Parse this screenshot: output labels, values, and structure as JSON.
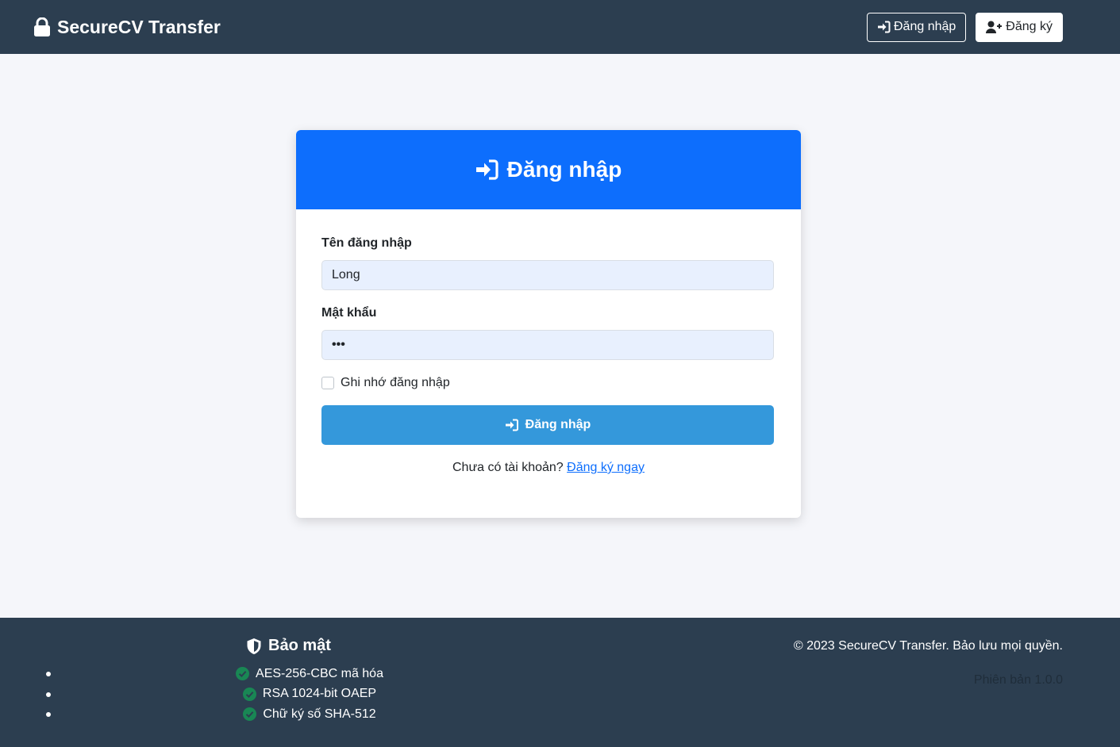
{
  "navbar": {
    "brand": "SecureCV Transfer",
    "login_label": "Đăng nhập",
    "register_label": "Đăng ký"
  },
  "card": {
    "title": "Đăng nhập",
    "username_label": "Tên đăng nhập",
    "username_value": "Long",
    "password_label": "Mật khẩu",
    "password_value": "•••",
    "remember_label": "Ghi nhớ đăng nhập",
    "remember_checked": false,
    "submit_label": "Đăng nhập",
    "no_account_text": "Chưa có tài khoản?",
    "signup_link": "Đăng ký ngay"
  },
  "footer": {
    "security_title": "Bảo mật",
    "security_items": [
      {
        "label": "AES-256-CBC mã hóa"
      },
      {
        "label": "RSA 1024-bit OAEP"
      },
      {
        "label": "Chữ ký số SHA-512"
      }
    ],
    "copyright": "© 2023 SecureCV Transfer. Bảo lưu mọi quyền.",
    "version": "Phiên bản 1.0.0"
  },
  "colors": {
    "navbar_bg": "#2c3e50",
    "card_header_bg": "#0d6efd",
    "submit_bg": "#3498db",
    "input_bg": "#e8f0fe",
    "check_green": "#198754"
  },
  "icons": {
    "brand": "lock-icon",
    "login": "sign-in-icon",
    "register": "user-plus-icon",
    "security": "shield-icon",
    "check": "check-circle-icon"
  }
}
